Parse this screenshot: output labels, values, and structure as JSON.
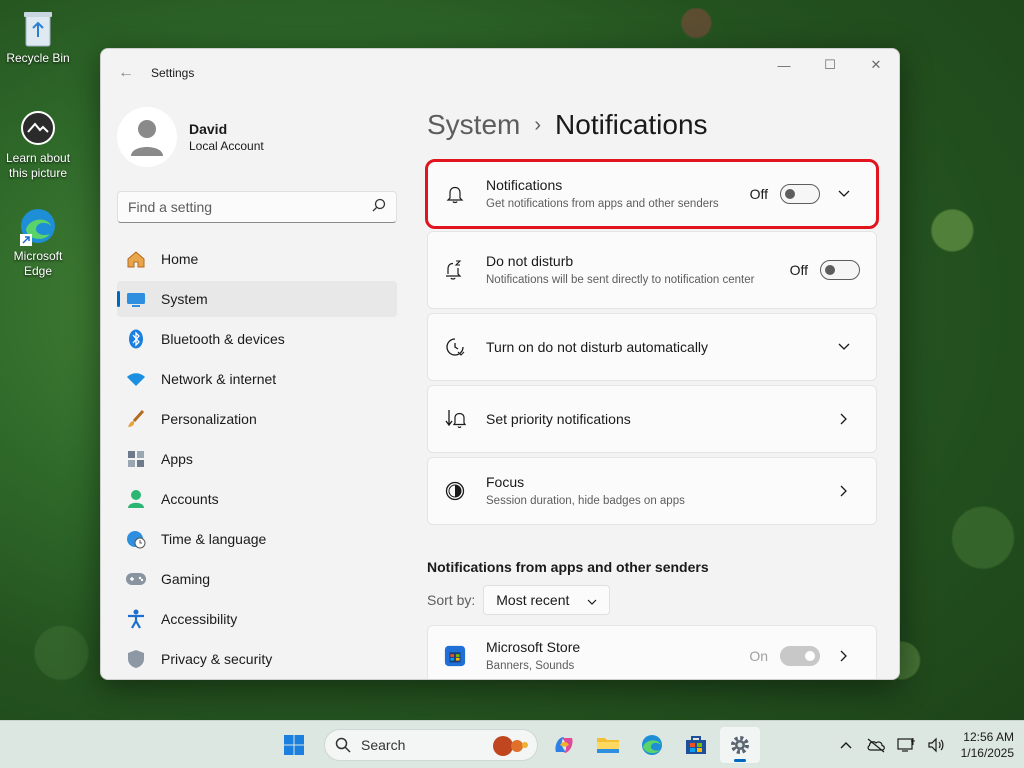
{
  "desktop": {
    "icons": [
      {
        "label": "Recycle Bin"
      },
      {
        "label": "Learn about this picture"
      },
      {
        "label": "Microsoft Edge"
      }
    ]
  },
  "window": {
    "title": "Settings",
    "controls": {
      "minimize": "—",
      "maximize": "☐",
      "close": "✕"
    }
  },
  "profile": {
    "name": "David",
    "account_type": "Local Account"
  },
  "search": {
    "placeholder": "Find a setting"
  },
  "nav": {
    "items": [
      {
        "label": "Home",
        "icon": "home-icon"
      },
      {
        "label": "System",
        "icon": "system-icon",
        "active": true
      },
      {
        "label": "Bluetooth & devices",
        "icon": "bluetooth-icon"
      },
      {
        "label": "Network & internet",
        "icon": "wifi-icon"
      },
      {
        "label": "Personalization",
        "icon": "brush-icon"
      },
      {
        "label": "Apps",
        "icon": "apps-icon"
      },
      {
        "label": "Accounts",
        "icon": "accounts-icon"
      },
      {
        "label": "Time & language",
        "icon": "globe-clock-icon"
      },
      {
        "label": "Gaming",
        "icon": "gamepad-icon"
      },
      {
        "label": "Accessibility",
        "icon": "accessibility-icon"
      },
      {
        "label": "Privacy & security",
        "icon": "shield-icon"
      }
    ]
  },
  "breadcrumb": {
    "parent": "System",
    "separator": "›",
    "current": "Notifications"
  },
  "cards": {
    "notifications": {
      "title": "Notifications",
      "desc": "Get notifications from apps and other senders",
      "state": "Off"
    },
    "dnd": {
      "title": "Do not disturb",
      "desc": "Notifications will be sent directly to notification center",
      "state": "Off"
    },
    "dnd_auto": {
      "title": "Turn on do not disturb automatically"
    },
    "priority": {
      "title": "Set priority notifications"
    },
    "focus": {
      "title": "Focus",
      "desc": "Session duration, hide badges on apps"
    }
  },
  "senders": {
    "section_title": "Notifications from apps and other senders",
    "sort_label": "Sort by:",
    "sort_value": "Most recent",
    "apps": [
      {
        "name": "Microsoft Store",
        "desc": "Banners, Sounds",
        "state": "On"
      }
    ]
  },
  "taskbar": {
    "search_label": "Search",
    "clock_time": "12:56 AM",
    "clock_date": "1/16/2025"
  },
  "colors": {
    "accent": "#0067c0",
    "highlight": "#e2141e"
  }
}
